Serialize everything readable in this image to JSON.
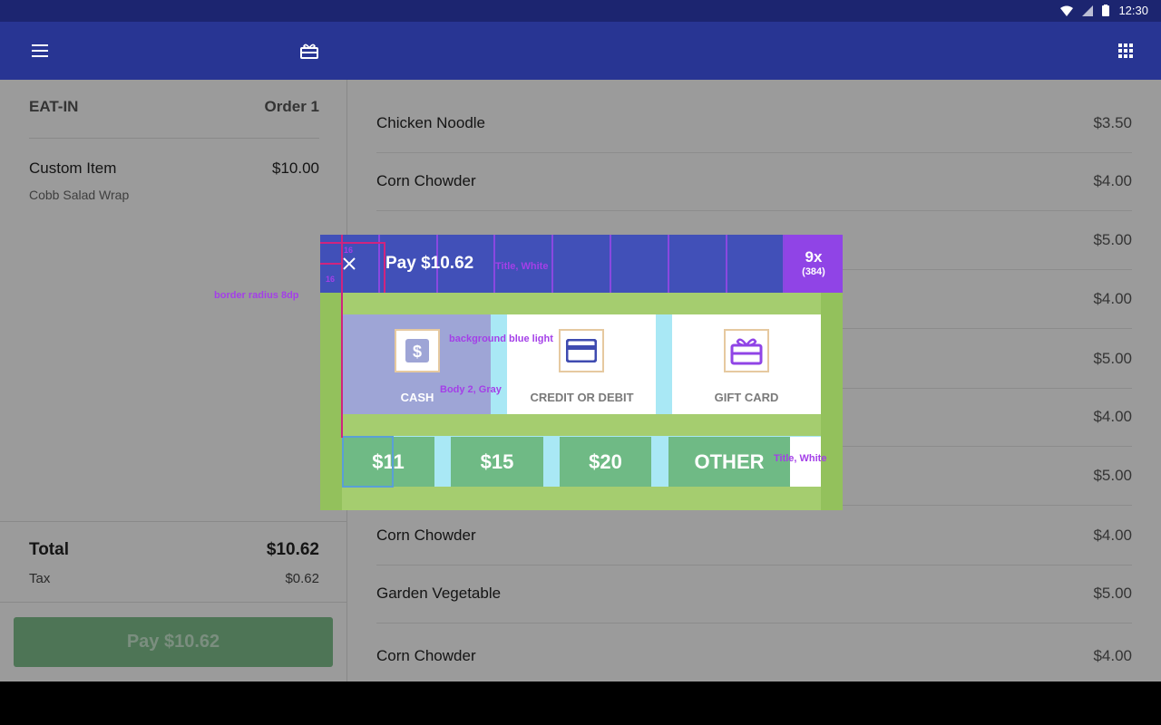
{
  "status_bar": {
    "time": "12:30"
  },
  "app_bar": {
    "menu_icon": "menu-icon",
    "gift_icon": "gift-card-icon",
    "grid_icon": "apps-grid-icon"
  },
  "order": {
    "type": "EAT-IN",
    "number": "Order 1",
    "items": [
      {
        "name": "Custom Item",
        "price": "$10.00",
        "detail": "Cobb Salad Wrap"
      }
    ],
    "total_label": "Total",
    "total_value": "$10.62",
    "tax_label": "Tax",
    "tax_value": "$0.62",
    "pay_button": "Pay $10.62"
  },
  "menu": [
    {
      "name": "Chicken Noodle",
      "price": "$3.50"
    },
    {
      "name": "Corn Chowder",
      "price": "$4.00"
    },
    {
      "name": "",
      "price": "$5.00"
    },
    {
      "name": "",
      "price": "$4.00"
    },
    {
      "name": "",
      "price": "$5.00"
    },
    {
      "name": "",
      "price": "$4.00"
    },
    {
      "name": "",
      "price": "$5.00"
    },
    {
      "name": "Corn Chowder",
      "price": "$4.00"
    },
    {
      "name": "Garden Vegetable",
      "price": "$5.00"
    },
    {
      "name": "Corn Chowder",
      "price": "$4.00"
    }
  ],
  "dialog": {
    "title": "Pay $10.62",
    "badge_main": "9x",
    "badge_sub": "(384)",
    "methods": [
      {
        "label": "CASH",
        "icon": "dollar-icon"
      },
      {
        "label": "CREDIT OR DEBIT",
        "icon": "credit-card-icon"
      },
      {
        "label": "GIFT CARD",
        "icon": "gift-card-icon"
      }
    ],
    "amounts": [
      "$11",
      "$15",
      "$20",
      "OTHER"
    ],
    "colors": {
      "header": "#4150b8",
      "accent": "#9044e6",
      "amount": "#6fba85"
    }
  },
  "annotations": {
    "title_spec": "Title, White",
    "border_spec": "border radius 8dp",
    "bg_spec": "background blue light",
    "body_spec": "Body 2, Gray",
    "amount_spec": "Title, White",
    "dim_a": "16",
    "dim_b": "16"
  }
}
